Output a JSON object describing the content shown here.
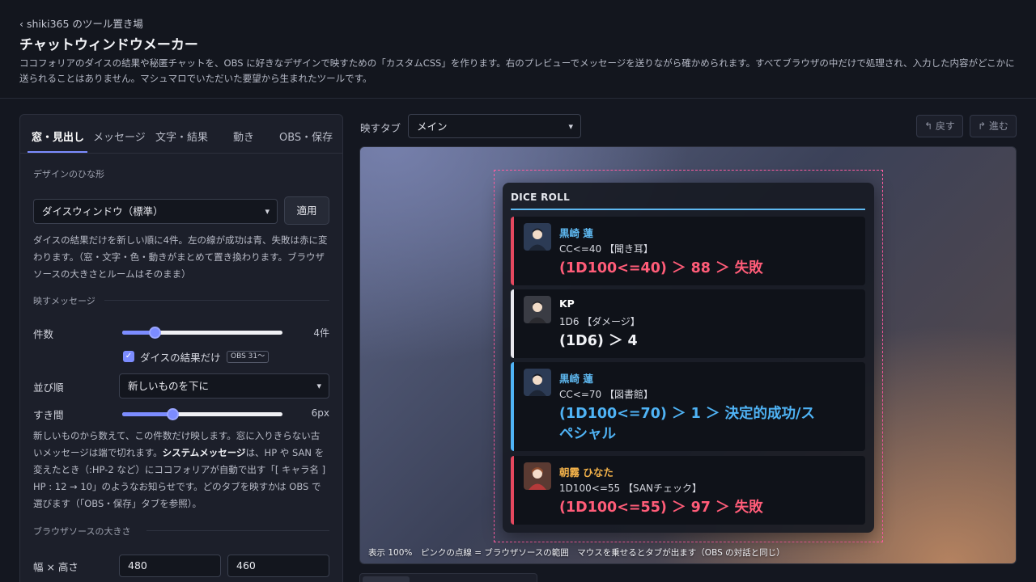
{
  "header": {
    "back_link": "‹ shiki365 のツール置き場",
    "title": "チャットウィンドウメーカー",
    "description": "ココフォリアのダイスの結果や秘匿チャットを、OBS に好きなデザインで映すための「カスタムCSS」を作ります。右のプレビューでメッセージを送りながら確かめられます。すべてブラウザの中だけで処理され、入力した内容がどこかに送られることはありません。マシュマロでいただいた要望から生まれたツールです。"
  },
  "panel": {
    "tabs": [
      "窓・見出し",
      "メッセージ",
      "文字・結果",
      "動き",
      "OBS・保存"
    ],
    "active_tab": "窓・見出し",
    "template_section": "デザインのひな形",
    "template_select": "ダイスウィンドウ（標準）",
    "apply_button": "適用",
    "template_help": "ダイスの結果だけを新しい順に4件。左の線が成功は青、失敗は赤に変わります。（窓・文字・色・動きがまとめて置き換わります。ブラウザソースの大きさとルームはそのまま）",
    "messages_section": "映すメッセージ",
    "count_label": "件数",
    "count_value": "4件",
    "count_fraction": 0.18,
    "dice_only_label": "ダイスの結果だけ",
    "dice_only_badge": "OBS 31〜",
    "dice_only_checked": true,
    "order_label": "並び順",
    "order_select": "新しいものを下に",
    "gap_label": "すき間",
    "gap_value": "6px",
    "gap_fraction": 0.3,
    "messages_help_1": "新しいものから数えて、この件数だけ映します。窓に入りきらない古いメッセージは端で切れます。",
    "messages_help_bold": "システムメッセージ",
    "messages_help_2": "は、HP や SAN を変えたとき（:HP-2 など）にココフォリアが自動で出す「[ キャラ名 ] HP : 12 → 10」のようなお知らせです。どのタブを映すかは OBS で選びます（「OBS・保存」タブを参照）。",
    "browser_section": "ブラウザソースの大きさ",
    "size_label": "幅 × 高さ",
    "width_value": "480",
    "height_value": "460"
  },
  "preview_toolbar": {
    "tab_label": "映すタブ",
    "tab_select": "メイン",
    "undo_button": "↰ 戻す",
    "redo_button": "↱ 進む"
  },
  "chat": {
    "window_title": "DICE ROLL",
    "messages": [
      {
        "speaker": "黒崎 蓮",
        "command": "CC<=40 【聞き耳】",
        "result": "(1D100<=40) ＞ 88 ＞ 失敗",
        "bar_color": "#e5485f",
        "name_color": "#5eb8f0",
        "result_color": "#ff5c78"
      },
      {
        "speaker": "KP",
        "command": "1D6 【ダメージ】",
        "result": "(1D6) ＞ 4",
        "bar_color": "#e8e8ee",
        "name_color": "#ffffff",
        "result_color": "#f0f1f5"
      },
      {
        "speaker": "黒崎 蓮",
        "command": "CC<=70 【図書館】",
        "result": "(1D100<=70) ＞ 1 ＞ 決定的成功/スペシャル",
        "bar_color": "#4fb3f5",
        "name_color": "#5eb8f0",
        "result_color": "#4fb3f5"
      },
      {
        "speaker": "朝霧 ひなた",
        "command": "1D100<=55 【SANチェック】",
        "result": "(1D100<=55) ＞ 97 ＞ 失敗",
        "bar_color": "#e5485f",
        "name_color": "#f3b24a",
        "result_color": "#ff5c78"
      }
    ],
    "caption": "表示 100%　ピンクの点線 = ブラウザソースの範囲　マウスを乗せるとタブが出ます（OBS の対話と同じ）"
  },
  "colors": {
    "accent": "#7c8cff",
    "frame": "#ff5fa2"
  },
  "icons": [
    "chevron-down-icon",
    "check-icon",
    "undo-icon",
    "redo-icon",
    "avatar-icon"
  ]
}
